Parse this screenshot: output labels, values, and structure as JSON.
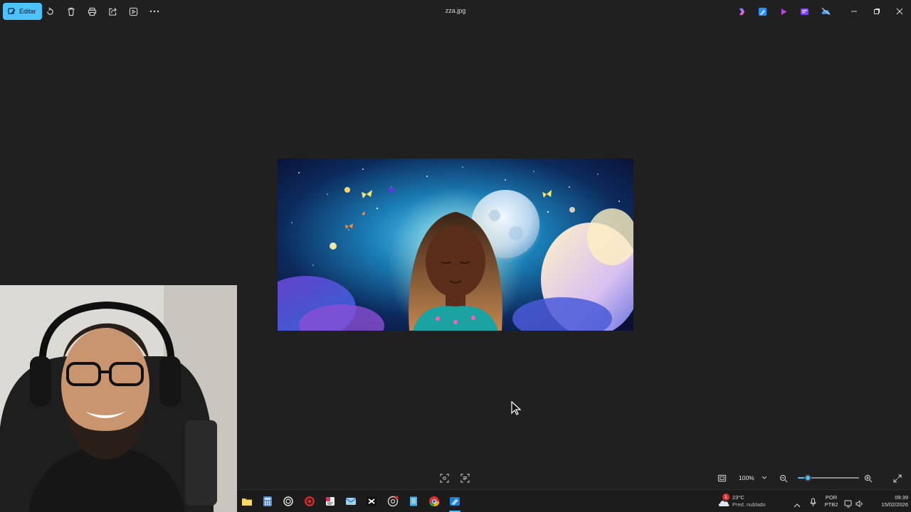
{
  "toolbar": {
    "edit_label": "Editar",
    "title": "zza.jpg",
    "icons": [
      "rotate-icon",
      "delete-icon",
      "print-icon",
      "share-icon",
      "slideshow-icon",
      "more-icon"
    ],
    "right_apps": [
      "copilot-icon",
      "photos-editor-icon",
      "clipchamp-icon",
      "designer-icon",
      "onedrive-off-icon"
    ],
    "window": [
      "minimize-icon",
      "restore-icon",
      "close-icon"
    ]
  },
  "viewer": {
    "zoom_value": "100%",
    "zoom_slider_fraction": 0.12
  },
  "taskbar": {
    "apps": [
      "file-explorer-icon",
      "calculator-icon",
      "chatgpt-icon",
      "obs-icon",
      "notes-icon",
      "mail-icon",
      "capcut-icon",
      "chrome-dev-icon",
      "notepad-icon",
      "chrome-icon",
      "photos-icon"
    ],
    "weather_temp": "23°C",
    "weather_desc": "Pred. nublado",
    "weather_badge": "1",
    "lang_line1": "POR",
    "lang_line2": "PTB2",
    "time": "09:39",
    "date": "15/02/2026"
  },
  "colors": {
    "accent": "#4cc2ff",
    "background": "#202020",
    "taskbar": "#1c1c1c"
  }
}
